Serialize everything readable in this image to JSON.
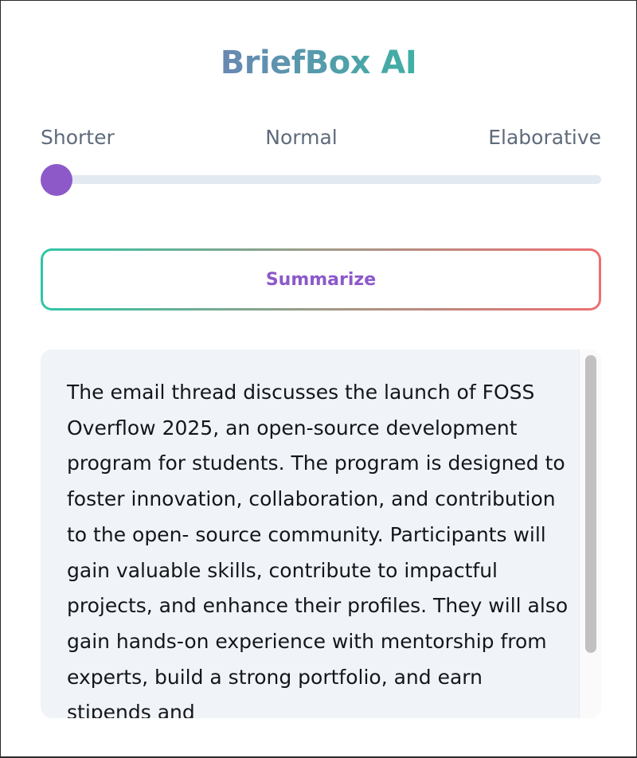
{
  "app": {
    "title": "BriefBox AI"
  },
  "length_slider": {
    "labels": [
      "Shorter",
      "Normal",
      "Elaborative"
    ],
    "value": 0
  },
  "actions": {
    "summarize_label": "Summarize"
  },
  "summary": {
    "text": "The email thread discusses the launch of FOSS Overflow 2025, an open-source development program for students. The program is designed to foster innovation, collaboration, and contribution to the open- source community. Participants will gain valuable skills, contribute to impactful projects, and enhance their profiles. They will also gain hands-on experience with mentorship from experts, build a strong portfolio, and earn stipends and",
    "scroll_position": 0
  },
  "colors": {
    "accent": "#8d59c9",
    "title_gradient_start": "#6a87b2",
    "title_gradient_end": "#3fb0a4",
    "button_border_start": "#2fc6a6",
    "button_border_end": "#ec6f72",
    "output_background": "#f0f4f8",
    "label_text": "#5f6b7c"
  }
}
